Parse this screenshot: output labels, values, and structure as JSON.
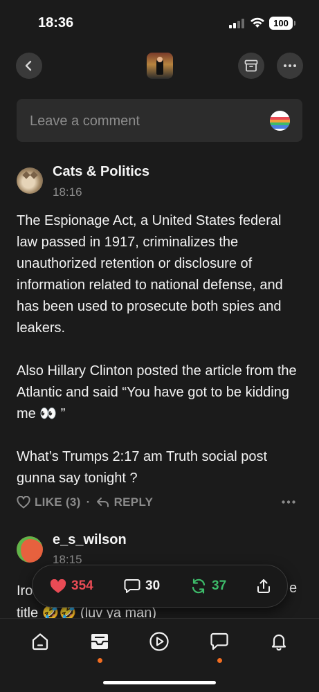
{
  "status_bar": {
    "time": "18:36",
    "battery": "100"
  },
  "header": {
    "back_icon": "chevron-left-icon",
    "archive_icon": "archive-icon",
    "more_icon": "more-horizontal-icon"
  },
  "comment_input": {
    "placeholder": "Leave a comment"
  },
  "comments": [
    {
      "author": "Cats & Politics",
      "time": "18:16",
      "paragraphs": [
        "The Espionage Act, a United States federal law passed in 1917, criminalizes the unauthorized retention or disclosure of information related to national defense, and has been used to prosecute both spies and leakers.",
        "Also Hillary Clinton posted the article from the Atlantic and said “You have got to be kidding me 👀 ”",
        "What’s Trumps 2:17 am Truth social post gunna say tonight ?"
      ],
      "like_label": "LIKE (3)",
      "reply_label": "REPLY",
      "separator": "·"
    },
    {
      "author": "e_s_wilson",
      "time": "18:15",
      "text_line1": "Iro",
      "text_line2": "title 🤣🤣 (luv ya man)",
      "text_trailing": "e"
    }
  ],
  "engagement": {
    "likes": "354",
    "comments": "30",
    "restacks": "37"
  },
  "colors": {
    "like": "#e94b55",
    "restack": "#3dbb6a",
    "accent": "#f26d21",
    "background": "#1b1b1b"
  },
  "tabs": [
    {
      "icon": "home-icon"
    },
    {
      "icon": "inbox-icon",
      "active": true
    },
    {
      "icon": "play-icon"
    },
    {
      "icon": "chat-icon",
      "badge": true
    },
    {
      "icon": "bell-icon"
    }
  ]
}
